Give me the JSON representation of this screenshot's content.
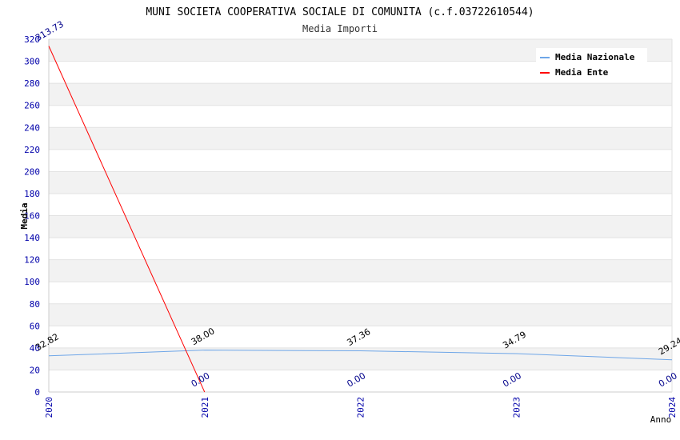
{
  "chart_data": {
    "type": "line",
    "title": "MUNI SOCIETA COOPERATIVA SOCIALE DI COMUNITA (c.f.03722610544)",
    "subtitle": "Media Importi",
    "xlabel": "Anno",
    "ylabel": "Media",
    "x": [
      "2020",
      "2021",
      "2022",
      "2023",
      "2024"
    ],
    "ylim": [
      0,
      320
    ],
    "yticks": [
      0,
      20,
      40,
      60,
      80,
      100,
      120,
      140,
      160,
      180,
      200,
      220,
      240,
      260,
      280,
      300,
      320
    ],
    "grid": true,
    "legend_position": "top-right",
    "series": [
      {
        "name": "Media Nazionale",
        "color": "#6ea6e8",
        "values": [
          32.82,
          38.0,
          37.36,
          34.79,
          29.24
        ],
        "labels": [
          "32.82",
          "38.00",
          "37.36",
          "34.79",
          "29.24"
        ],
        "label_color": "#000000"
      },
      {
        "name": "Media Ente",
        "color": "#ff0000",
        "values": [
          313.73,
          0.0
        ],
        "labels": [
          "313.73",
          "0.00"
        ],
        "label_color": "#00008b"
      }
    ],
    "zero_labels": {
      "x": [
        "2022",
        "2023",
        "2024"
      ],
      "labels": [
        "0.00",
        "0.00",
        "0.00"
      ],
      "color": "#00008b"
    }
  }
}
